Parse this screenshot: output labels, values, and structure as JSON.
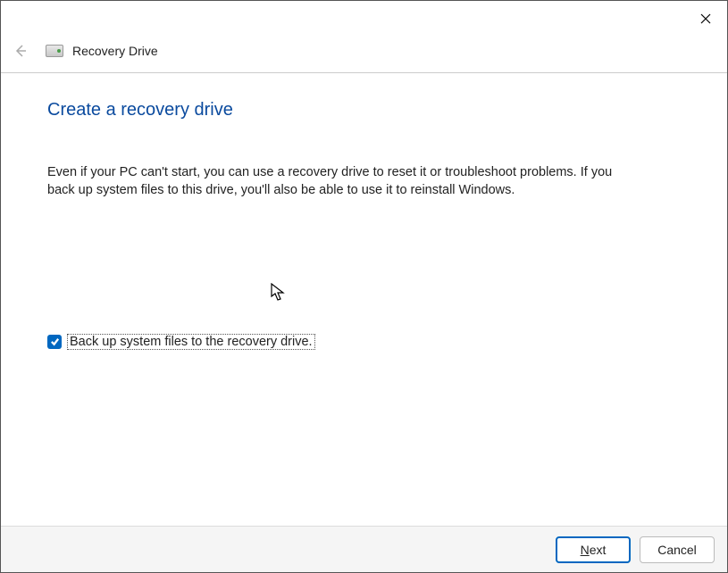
{
  "header": {
    "app_title": "Recovery Drive"
  },
  "page": {
    "title": "Create a recovery drive",
    "description": "Even if your PC can't start, you can use a recovery drive to reset it or troubleshoot problems. If you back up system files to this drive, you'll also be able to use it to reinstall Windows."
  },
  "checkbox": {
    "label": "Back up system files to the recovery drive.",
    "checked": true
  },
  "footer": {
    "next_label": "Next",
    "cancel_label": "Cancel"
  }
}
